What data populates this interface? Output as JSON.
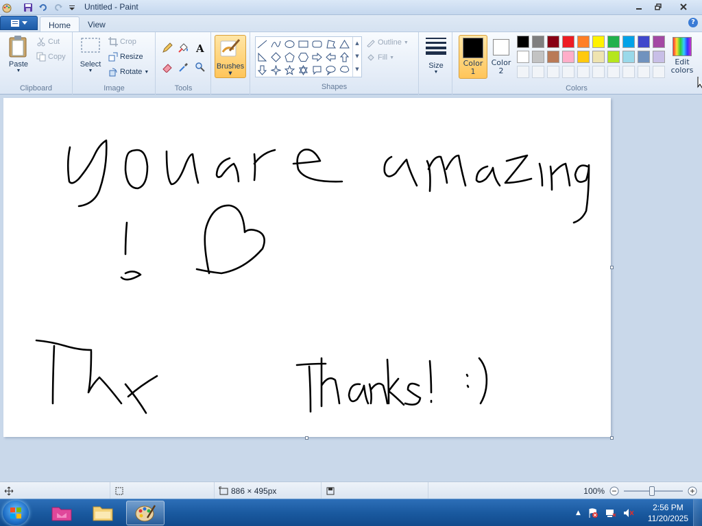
{
  "window": {
    "title": "Untitled - Paint"
  },
  "tabs": [
    {
      "label": "Home"
    },
    {
      "label": "View"
    }
  ],
  "ribbon": {
    "clipboard": {
      "group_label": "Clipboard",
      "paste": "Paste",
      "cut": "Cut",
      "copy": "Copy"
    },
    "image": {
      "group_label": "Image",
      "select": "Select",
      "crop": "Crop",
      "resize": "Resize",
      "rotate": "Rotate"
    },
    "tools": {
      "group_label": "Tools"
    },
    "brushes": {
      "label": "Brushes"
    },
    "shapes": {
      "group_label": "Shapes",
      "outline": "Outline",
      "fill": "Fill"
    },
    "size": {
      "label": "Size"
    },
    "colors": {
      "group_label": "Colors",
      "color1": {
        "line1": "Color",
        "line2": "1",
        "value": "#000000"
      },
      "color2": {
        "line1": "Color",
        "line2": "2",
        "value": "#ffffff"
      },
      "edit_colors": {
        "line1": "Edit",
        "line2": "colors"
      },
      "palette_row1": [
        "#000000",
        "#7f7f7f",
        "#880015",
        "#ed1c24",
        "#ff7f27",
        "#fff200",
        "#22b14c",
        "#00a2e8",
        "#3f48cc",
        "#a349a4"
      ],
      "palette_row2": [
        "#ffffff",
        "#c3c3c3",
        "#b97a57",
        "#ffaec9",
        "#ffc90e",
        "#efe4b0",
        "#b5e61d",
        "#99d9ea",
        "#7092be",
        "#c8bfe7"
      ]
    }
  },
  "canvas": {
    "accent": "#000000",
    "drawing_strokes": [
      "you are amazing",
      "heart",
      "Thx",
      "Thanks! :)"
    ]
  },
  "status": {
    "dimensions": "886 × 495px",
    "zoom": "100%"
  },
  "taskbar": {
    "time": "2:56 PM",
    "date": "11/20/2025"
  }
}
